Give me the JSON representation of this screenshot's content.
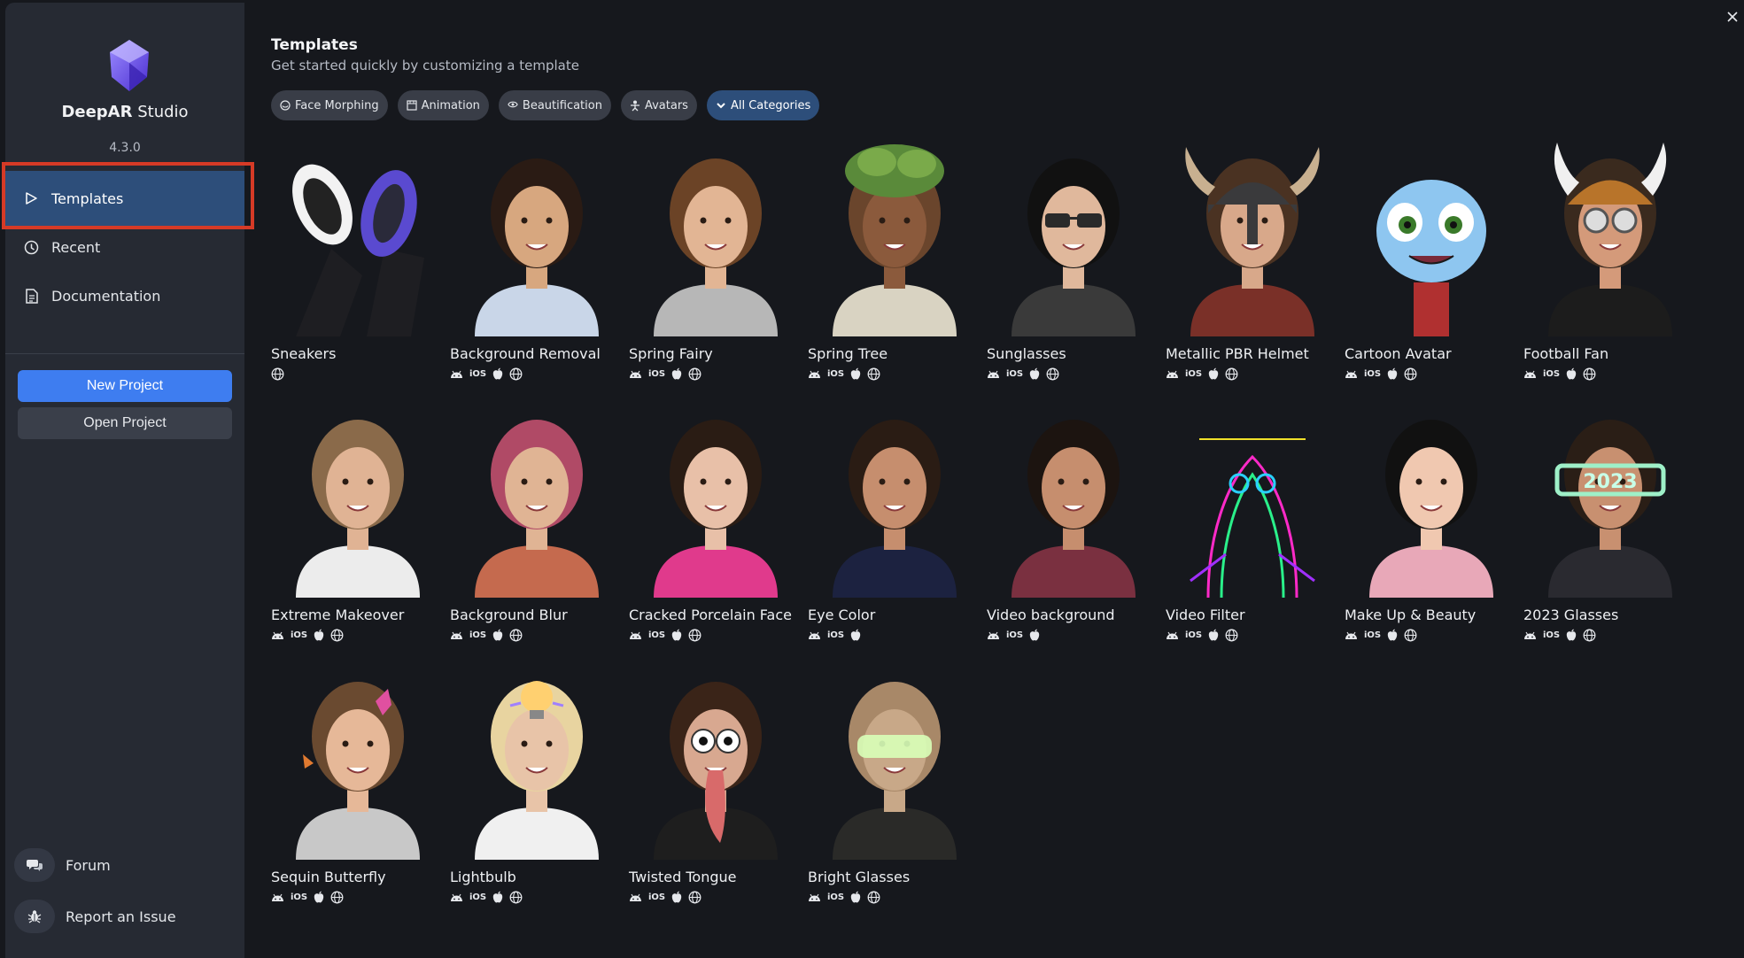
{
  "app": {
    "brand_bold": "DeepAR",
    "brand_light": " Studio",
    "version": "4.3.0"
  },
  "sidebar": {
    "nav": [
      {
        "label": "Templates",
        "icon": "play-outline-icon",
        "active": true
      },
      {
        "label": "Recent",
        "icon": "clock-icon",
        "active": false
      },
      {
        "label": "Documentation",
        "icon": "document-icon",
        "active": false
      }
    ],
    "new_project": "New Project",
    "open_project": "Open Project",
    "forum": "Forum",
    "report_issue": "Report an Issue"
  },
  "main": {
    "title": "Templates",
    "subtitle": "Get started quickly by customizing a template",
    "filters": [
      {
        "label": "Face Morphing",
        "icon": "face-morphing-icon",
        "selected": false
      },
      {
        "label": "Animation",
        "icon": "animation-icon",
        "selected": false
      },
      {
        "label": "Beautification",
        "icon": "eye-icon",
        "selected": false
      },
      {
        "label": "Avatars",
        "icon": "avatar-icon",
        "selected": false
      },
      {
        "label": "All Categories",
        "icon": "chevron-down-icon",
        "selected": true
      }
    ]
  },
  "templates": [
    {
      "title": "Sneakers",
      "platforms": [
        "web"
      ]
    },
    {
      "title": "Background Removal",
      "platforms": [
        "android",
        "ios",
        "apple",
        "web"
      ]
    },
    {
      "title": "Spring Fairy",
      "platforms": [
        "android",
        "ios",
        "apple",
        "web"
      ]
    },
    {
      "title": "Spring Tree",
      "platforms": [
        "android",
        "ios",
        "apple",
        "web"
      ]
    },
    {
      "title": "Sunglasses",
      "platforms": [
        "android",
        "ios",
        "apple",
        "web"
      ]
    },
    {
      "title": "Metallic PBR Helmet",
      "platforms": [
        "android",
        "ios",
        "apple",
        "web"
      ]
    },
    {
      "title": "Cartoon Avatar",
      "platforms": [
        "android",
        "ios",
        "apple",
        "web"
      ]
    },
    {
      "title": "Football Fan",
      "platforms": [
        "android",
        "ios",
        "apple",
        "web"
      ]
    },
    {
      "title": "Extreme Makeover",
      "platforms": [
        "android",
        "ios",
        "apple",
        "web"
      ]
    },
    {
      "title": "Background Blur",
      "platforms": [
        "android",
        "ios",
        "apple",
        "web"
      ]
    },
    {
      "title": "Cracked Porcelain Face",
      "platforms": [
        "android",
        "ios",
        "apple",
        "web"
      ]
    },
    {
      "title": "Eye Color",
      "platforms": [
        "android",
        "ios",
        "apple"
      ]
    },
    {
      "title": "Video background",
      "platforms": [
        "android",
        "ios",
        "apple"
      ]
    },
    {
      "title": "Video Filter",
      "platforms": [
        "android",
        "ios",
        "apple",
        "web"
      ]
    },
    {
      "title": "Make Up & Beauty",
      "platforms": [
        "android",
        "ios",
        "apple",
        "web"
      ]
    },
    {
      "title": "2023 Glasses",
      "platforms": [
        "android",
        "ios",
        "apple",
        "web"
      ]
    },
    {
      "title": "Sequin Butterfly",
      "platforms": [
        "android",
        "ios",
        "apple",
        "web"
      ]
    },
    {
      "title": "Lightbulb",
      "platforms": [
        "android",
        "ios",
        "apple",
        "web"
      ]
    },
    {
      "title": "Twisted Tongue",
      "platforms": [
        "android",
        "ios",
        "apple",
        "web"
      ]
    },
    {
      "title": "Bright Glasses",
      "platforms": [
        "android",
        "ios",
        "apple",
        "web"
      ]
    }
  ],
  "platform_labels": {
    "ios": "iOS"
  },
  "colors": {
    "accent_blue": "#3e7df0",
    "active_nav": "#2d4e7a",
    "highlight_outline": "#d63a26",
    "sidebar_bg": "#262a33",
    "main_bg": "#16181d"
  }
}
